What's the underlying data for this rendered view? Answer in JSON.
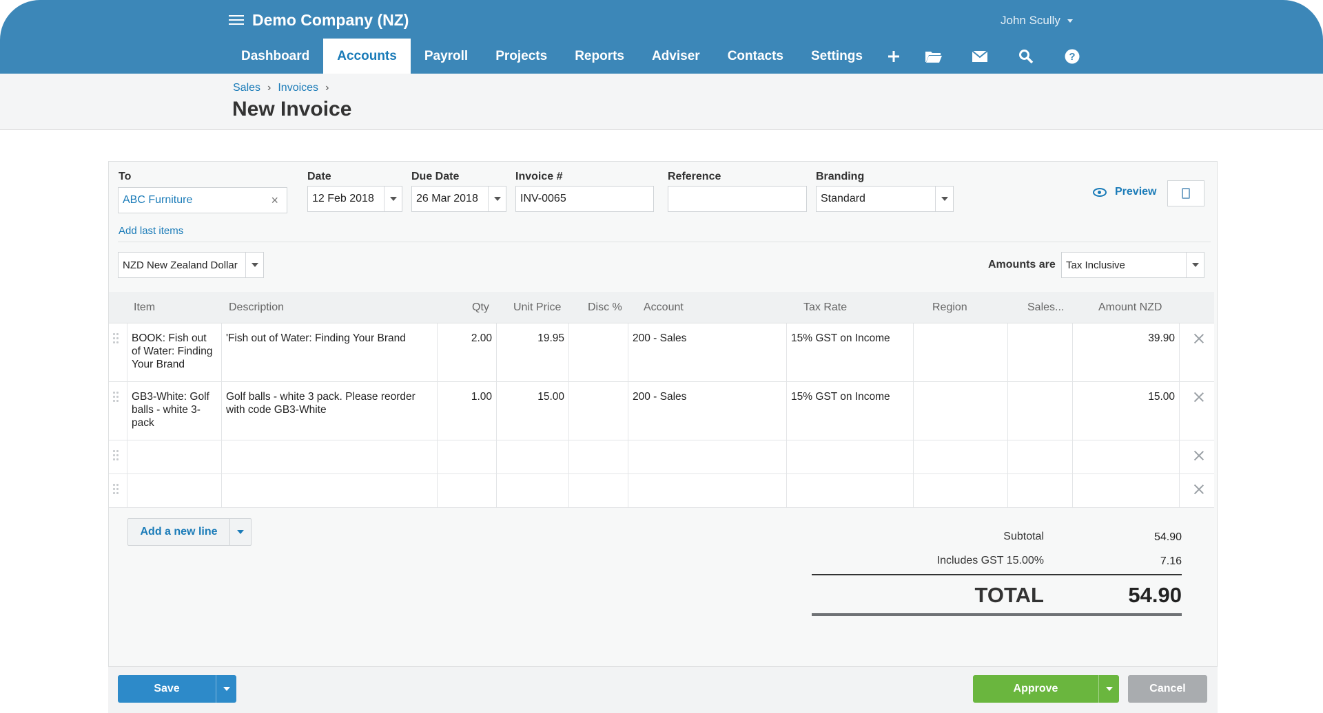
{
  "header": {
    "org_name": "Demo Company (NZ)",
    "user_name": "John Scully",
    "nav_tabs": [
      {
        "label": "Dashboard"
      },
      {
        "label": "Accounts",
        "active": true
      },
      {
        "label": "Payroll"
      },
      {
        "label": "Projects"
      },
      {
        "label": "Reports"
      },
      {
        "label": "Adviser"
      },
      {
        "label": "Contacts"
      },
      {
        "label": "Settings"
      }
    ],
    "icons": [
      "plus-icon",
      "folder-icon",
      "mail-icon",
      "search-icon",
      "help-icon"
    ]
  },
  "breadcrumb": [
    "Sales",
    "Invoices"
  ],
  "page_title": "New Invoice",
  "form": {
    "to_label": "To",
    "to_value": "ABC Furniture",
    "date_label": "Date",
    "date_value": "12 Feb 2018",
    "due_date_label": "Due Date",
    "due_date_value": "26 Mar 2018",
    "invoice_no_label": "Invoice #",
    "invoice_no_value": "INV-0065",
    "reference_label": "Reference",
    "reference_value": "",
    "branding_label": "Branding",
    "branding_value": "Standard",
    "preview_label": "Preview",
    "add_last_items": "Add last items",
    "currency_value": "NZD New Zealand Dollar",
    "amounts_are_label": "Amounts are",
    "amounts_are_value": "Tax Inclusive"
  },
  "table": {
    "headers": [
      "Item",
      "Description",
      "Qty",
      "Unit Price",
      "Disc %",
      "Account",
      "Tax Rate",
      "Region",
      "Sales...",
      "Amount NZD"
    ],
    "rows": [
      {
        "item": "BOOK: Fish out of Water: Finding Your Brand",
        "description": "'Fish out of Water: Finding Your Brand",
        "qty": "2.00",
        "unit_price": "19.95",
        "disc": "",
        "account": "200 - Sales",
        "tax_rate": "15% GST on Income",
        "region": "",
        "sales": "",
        "amount": "39.90"
      },
      {
        "item": "GB3-White: Golf balls - white 3-pack",
        "description": "Golf balls - white 3 pack. Please reorder with code GB3-White",
        "qty": "1.00",
        "unit_price": "15.00",
        "disc": "",
        "account": "200 - Sales",
        "tax_rate": "15% GST on Income",
        "region": "",
        "sales": "",
        "amount": "15.00"
      }
    ]
  },
  "add_line_label": "Add a new line",
  "totals": {
    "subtotal_label": "Subtotal",
    "subtotal_value": "54.90",
    "gst_label": "Includes GST 15.00%",
    "gst_value": "7.16",
    "total_label": "TOTAL",
    "total_value": "54.90"
  },
  "actions": {
    "save": "Save",
    "approve": "Approve",
    "cancel": "Cancel"
  },
  "colors": {
    "header_blue": "#3c87b8",
    "link_blue": "#1a7bb8",
    "save_blue": "#2d8ac9",
    "approve_green": "#6ab63e",
    "cancel_gray": "#a9acaf"
  }
}
